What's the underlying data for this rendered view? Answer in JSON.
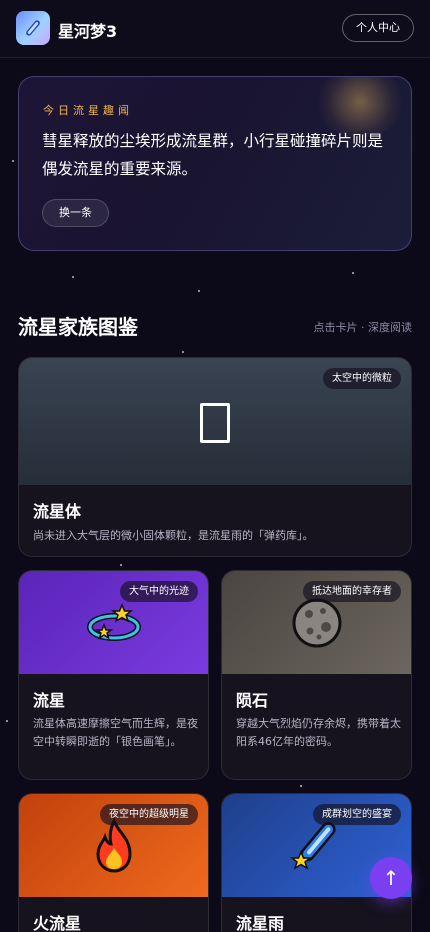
{
  "header": {
    "app_title": "星河梦3",
    "logo_icon": "meteor-icon",
    "profile_button": "个人中心"
  },
  "fact": {
    "label": "今日流星趣闻",
    "text": "彗星释放的尘埃形成流星群，小行星碰撞碎片则是偶发流星的重要来源。",
    "swap_button": "换一条"
  },
  "section": {
    "title": "流星家族图鉴",
    "hint": "点击卡片 · 深度阅读"
  },
  "cards": [
    {
      "title": "流星体",
      "tag": "太空中的微粒",
      "desc": "尚未进入大气层的微小固体颗粒，是流星雨的「弹药库」。",
      "icon": "missing-glyph-icon",
      "color": "#2f3845"
    },
    {
      "title": "流星",
      "tag": "大气中的光迹",
      "desc": "流星体高速摩擦空气而生辉，是夜空中转瞬即逝的「银色画笔」。",
      "icon": "ringed-star-icon",
      "color": "#6a2fd0"
    },
    {
      "title": "陨石",
      "tag": "抵达地面的幸存者",
      "desc": "穿越大气烈焰仍存余烬，携带着太阳系46亿年的密码。",
      "icon": "rock-icon",
      "color": "#5a554e"
    },
    {
      "title": "火流星",
      "tag": "夜空中的超级明星",
      "desc": "",
      "icon": "fire-icon",
      "color": "#e0581a"
    },
    {
      "title": "流星雨",
      "tag": "成群划空的盛宴",
      "desc": "",
      "icon": "shooting-star-icon",
      "color": "#2850b0"
    }
  ],
  "scroll_top_button": "↑",
  "accent_color": "#7b3ff2"
}
